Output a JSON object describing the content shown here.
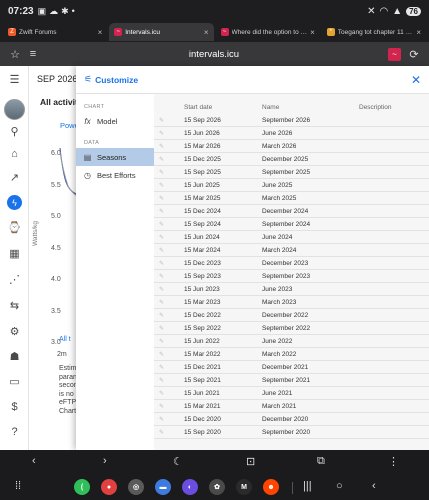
{
  "status": {
    "time": "07:23",
    "battery": "76"
  },
  "tabs": [
    {
      "title": "Zwift Forums",
      "color": "#f05a28",
      "glyph": "Z"
    },
    {
      "title": "Intervals.icu",
      "color": "#d1244e",
      "glyph": "~",
      "active": true
    },
    {
      "title": "Where did the option to ch...",
      "color": "#d1244e",
      "glyph": "~"
    },
    {
      "title": "Toegang tot chapter 11 gev...",
      "color": "#e3a530",
      "glyph": "*"
    }
  ],
  "urlbar": {
    "url": "intervals.icu"
  },
  "background": {
    "month": "SEP 2026",
    "title": "All activities",
    "power_label": "Powe",
    "y_label": "Watts/kg",
    "y_ticks": [
      "6.0",
      "5.5",
      "5.0",
      "4.5",
      "4.0",
      "3.5",
      "3.0"
    ],
    "x_tick": "2m",
    "all_label": "All t",
    "footnote_lines": [
      "Estim",
      "paran",
      "secon",
      "is no",
      "eFTP",
      "Chart"
    ]
  },
  "dialog": {
    "title": "Customize",
    "sidebar": {
      "chart_section": "CHART",
      "model_label": "Model",
      "data_section": "DATA",
      "seasons_label": "Seasons",
      "best_efforts_label": "Best Efforts"
    },
    "columns": {
      "start_date": "Start date",
      "name": "Name",
      "description": "Description"
    },
    "seasons": [
      {
        "start_date": "15 Sep 2026",
        "name": "September 2026"
      },
      {
        "start_date": "15 Jun 2026",
        "name": "June 2026"
      },
      {
        "start_date": "15 Mar 2026",
        "name": "March 2026"
      },
      {
        "start_date": "15 Dec 2025",
        "name": "December 2025"
      },
      {
        "start_date": "15 Sep 2025",
        "name": "September 2025"
      },
      {
        "start_date": "15 Jun 2025",
        "name": "June 2025"
      },
      {
        "start_date": "15 Mar 2025",
        "name": "March 2025"
      },
      {
        "start_date": "15 Dec 2024",
        "name": "December 2024"
      },
      {
        "start_date": "15 Sep 2024",
        "name": "September 2024"
      },
      {
        "start_date": "15 Jun 2024",
        "name": "June 2024"
      },
      {
        "start_date": "15 Mar 2024",
        "name": "March 2024"
      },
      {
        "start_date": "15 Dec 2023",
        "name": "December 2023"
      },
      {
        "start_date": "15 Sep 2023",
        "name": "September 2023"
      },
      {
        "start_date": "15 Jun 2023",
        "name": "June 2023"
      },
      {
        "start_date": "15 Mar 2023",
        "name": "March 2023"
      },
      {
        "start_date": "15 Dec 2022",
        "name": "December 2022"
      },
      {
        "start_date": "15 Sep 2022",
        "name": "September 2022"
      },
      {
        "start_date": "15 Jun 2022",
        "name": "June 2022"
      },
      {
        "start_date": "15 Mar 2022",
        "name": "March 2022"
      },
      {
        "start_date": "15 Dec 2021",
        "name": "December 2021"
      },
      {
        "start_date": "15 Sep 2021",
        "name": "September 2021"
      },
      {
        "start_date": "15 Jun 2021",
        "name": "June 2021"
      },
      {
        "start_date": "15 Mar 2021",
        "name": "March 2021"
      },
      {
        "start_date": "15 Dec 2020",
        "name": "December 2020"
      },
      {
        "start_date": "15 Sep 2020",
        "name": "September 2020"
      }
    ]
  },
  "dock_apps": [
    {
      "name": "phone",
      "color": "#2fbf5a",
      "glyph": "(",
      "icon": "phone-icon"
    },
    {
      "name": "contacts",
      "color": "#e04040",
      "glyph": "●",
      "icon": "person-icon"
    },
    {
      "name": "camera",
      "color": "#5a5a5a",
      "glyph": "◎",
      "icon": "camera-icon"
    },
    {
      "name": "messages",
      "color": "#3d7be0",
      "glyph": "▬",
      "icon": "message-icon"
    },
    {
      "name": "browser",
      "color": "#6b4de0",
      "glyph": "◐",
      "icon": "browser-icon"
    },
    {
      "name": "openai",
      "color": "#4a4a4a",
      "glyph": "✿",
      "icon": "openai-icon"
    },
    {
      "name": "mail",
      "color": "#2a2a2a",
      "glyph": "M",
      "icon": "mail-icon"
    },
    {
      "name": "reddit",
      "color": "#ff4500",
      "glyph": "☻",
      "icon": "reddit-icon"
    }
  ]
}
